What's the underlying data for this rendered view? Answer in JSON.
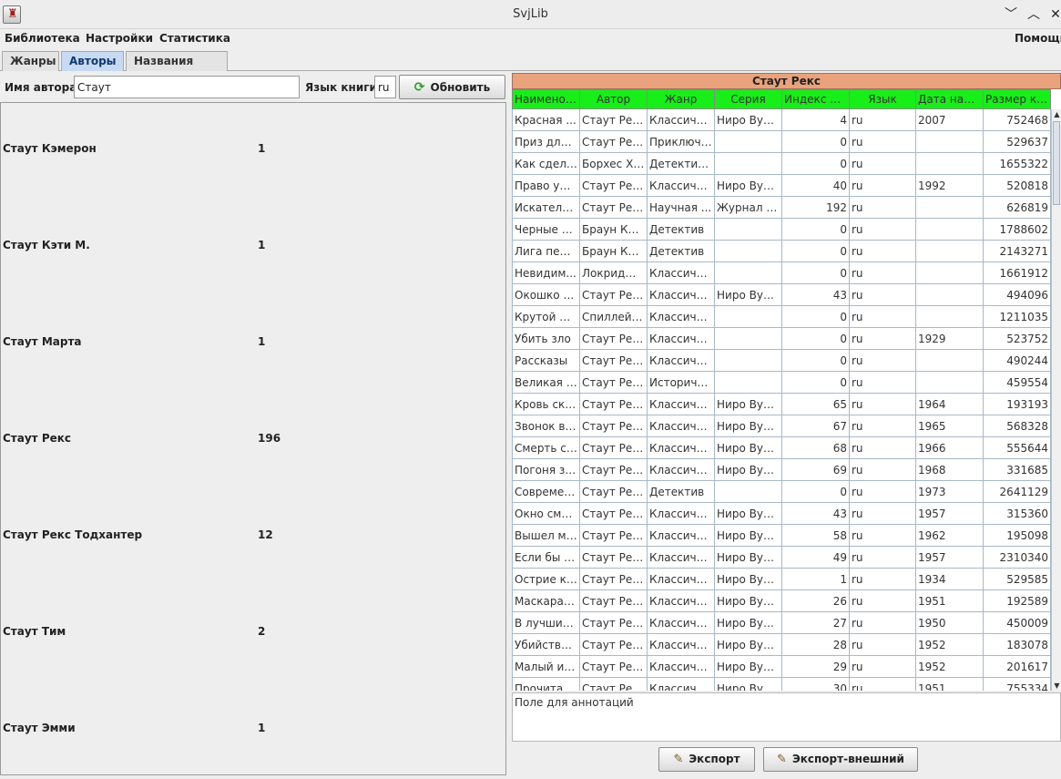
{
  "window": {
    "title": "SvjLib"
  },
  "menu": [
    "Библиотека",
    "Настройки",
    "Статистика",
    "Помощь"
  ],
  "tabs": [
    "Жанры",
    "Авторы",
    "Названия книг"
  ],
  "search": {
    "author_label": "Имя автора",
    "author_value": "Стаут",
    "lang_label": "Язык книги",
    "lang_value": "ru",
    "refresh_label": "Обновить"
  },
  "authors": [
    {
      "name": "Стаут Кэмерон",
      "count": "1"
    },
    {
      "name": "Стаут Кэти М.",
      "count": "1"
    },
    {
      "name": "Стаут Марта",
      "count": "1"
    },
    {
      "name": "Стаут Рекс",
      "count": "196"
    },
    {
      "name": "Стаут Рекс Тодхантер",
      "count": "12"
    },
    {
      "name": "Стаут Тим",
      "count": "2"
    },
    {
      "name": "Стаут Эмми",
      "count": "1"
    }
  ],
  "selected_author": "Стаут Рекс",
  "books": {
    "columns": [
      "Наименов...",
      "Автор",
      "Жанр",
      "Серия",
      "Индекс в с...",
      "Язык",
      "Дата напи...",
      "Размер кн..."
    ],
    "rows": [
      [
        "Красная ...",
        "Стаут Рекс",
        "Классичес...",
        "Ниро Вульф",
        "4",
        "ru",
        "2007",
        "752468"
      ],
      [
        "Приз для ...",
        "Стаут Рекс",
        "Приключе...",
        "",
        "0",
        "ru",
        "",
        "529637"
      ],
      [
        "Как сдела...",
        "Борхес Хо...",
        "Детектив, ...",
        "",
        "0",
        "ru",
        "",
        "1655322"
      ],
      [
        "Право уме...",
        "Стаут Рекс",
        "Классичес...",
        "Ниро Вульф",
        "40",
        "ru",
        "1992",
        "520818"
      ],
      [
        "Искатель. ...",
        "Стаут Рекс",
        "Научная ...",
        "Журнал 'И...",
        "192",
        "ru",
        "",
        "626819"
      ],
      [
        "Черные о...",
        "Браун Кар...",
        "Детектив",
        "",
        "0",
        "ru",
        "",
        "1788602"
      ],
      [
        "Лига пере...",
        "Браун Кар...",
        "Детектив",
        "",
        "0",
        "ru",
        "",
        "2143271"
      ],
      [
        "Невидим...",
        "Локридж ...",
        "Классичес...",
        "",
        "0",
        "ru",
        "",
        "1661912"
      ],
      [
        "Окошко д...",
        "Стаут Рекс",
        "Классичес...",
        "Ниро Вульф",
        "43",
        "ru",
        "",
        "494096"
      ],
      [
        "Крутой де...",
        "Спиллейн...",
        "Классичес...",
        "",
        "0",
        "ru",
        "",
        "1211035"
      ],
      [
        "Убить зло",
        "Стаут Рекс",
        "Классичес...",
        "",
        "0",
        "ru",
        "1929",
        "523752"
      ],
      [
        "Рассказы",
        "Стаут Рекс",
        "Классичес...",
        "",
        "0",
        "ru",
        "",
        "490244"
      ],
      [
        "Великая л...",
        "Стаут Рекс",
        "Историче...",
        "",
        "0",
        "ru",
        "",
        "459554"
      ],
      [
        "Кровь ска...",
        "Стаут Рекс",
        "Классичес...",
        "Ниро Вульф",
        "65",
        "ru",
        "1964",
        "193193"
      ],
      [
        "Звонок в д...",
        "Стаут Рекс",
        "Классичес...",
        "Ниро Вульф",
        "67",
        "ru",
        "1965",
        "568328"
      ],
      [
        "Смерть со...",
        "Стаут Рекс",
        "Классичес...",
        "Ниро Вульф",
        "68",
        "ru",
        "1966",
        "555644"
      ],
      [
        "Погоня за ...",
        "Стаут Рекс",
        "Классичес...",
        "Ниро Вульф",
        "69",
        "ru",
        "1968",
        "331685"
      ],
      [
        "Современ...",
        "Стаут Рекс",
        "Детектив",
        "",
        "0",
        "ru",
        "1973",
        "2641129"
      ],
      [
        "Окно смер...",
        "Стаут Рекс",
        "Классичес...",
        "Ниро Вульф",
        "43",
        "ru",
        "1957",
        "315360"
      ],
      [
        "Вышел ме...",
        "Стаут Рекс",
        "Классичес...",
        "Ниро Вульф",
        "58",
        "ru",
        "1962",
        "195098"
      ],
      [
        "Если бы с...",
        "Стаут Рекс",
        "Классичес...",
        "Ниро Вульф",
        "49",
        "ru",
        "1957",
        "2310340"
      ],
      [
        "Острие ко...",
        "Стаут Рекс",
        "Классичес...",
        "Ниро Вульф",
        "1",
        "ru",
        "1934",
        "529585"
      ],
      [
        "Маскарад ...",
        "Стаут Рекс",
        "Классичес...",
        "Ниро Вульф",
        "26",
        "ru",
        "1951",
        "192589"
      ],
      [
        "В лучших ...",
        "Стаут Рекс",
        "Классичес...",
        "Ниро Вульф",
        "27",
        "ru",
        "1950",
        "450009"
      ],
      [
        "Убийство ...",
        "Стаут Рекс",
        "Классичес...",
        "Ниро Вульф",
        "28",
        "ru",
        "1952",
        "183078"
      ],
      [
        "Малый и ...",
        "Стаут Рекс",
        "Классичес...",
        "Ниро Вульф",
        "29",
        "ru",
        "1952",
        "201617"
      ],
      [
        "Прочитав...",
        "Стаут Рекс",
        "Классичес...",
        "Ниро Вульф",
        "30",
        "ru",
        "1951",
        "755334"
      ]
    ]
  },
  "annotation_placeholder": "Поле для аннотаций",
  "buttons": {
    "export": "Экспорт",
    "export_external": "Экспорт-внешний"
  },
  "icons": {
    "app": "book-app-icon",
    "window_controls": [
      "minimize-icon",
      "maximize-icon",
      "close-icon"
    ],
    "refresh": "refresh-icon",
    "export": "export-icon"
  },
  "colors": {
    "header_accent": "#e9a27c",
    "column_header": "#18ee18",
    "active_tab": "#c8daf2"
  }
}
